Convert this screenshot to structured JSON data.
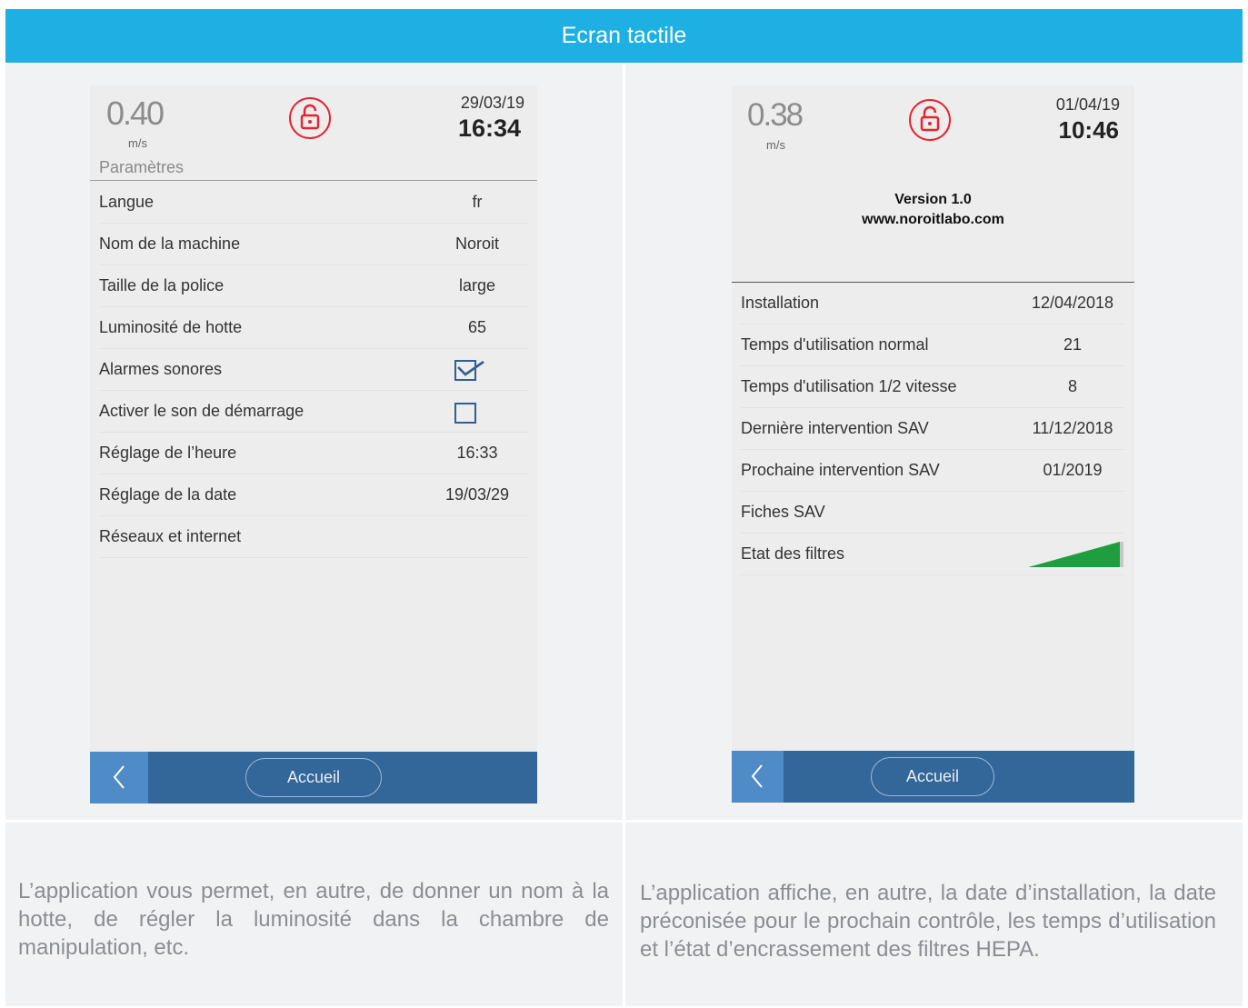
{
  "header": {
    "title": "Ecran tactile"
  },
  "left_screen": {
    "speed": "0.40",
    "unit": "m/s",
    "date": "29/03/19",
    "time": "16:34",
    "section_title": "Paramètres",
    "rows": [
      {
        "label": "Langue",
        "value": "fr"
      },
      {
        "label": "Nom de la machine",
        "value": "Noroit"
      },
      {
        "label": "Taille de la police",
        "value": "large"
      },
      {
        "label": "Luminosité de hotte",
        "value": "65"
      },
      {
        "label": "Alarmes sonores",
        "checkbox": true
      },
      {
        "label": "Activer le son de démarrage",
        "checkbox": false
      },
      {
        "label": "Réglage de l’heure",
        "value": "16:33"
      },
      {
        "label": "Réglage de la date",
        "value": "19/03/29"
      },
      {
        "label": "Réseaux et internet",
        "value": ""
      }
    ],
    "home_label": "Accueil"
  },
  "right_screen": {
    "speed": "0.38",
    "unit": "m/s",
    "date": "01/04/19",
    "time": "10:46",
    "version": "Version 1.0",
    "website": "www.noroitlabo.com",
    "rows": [
      {
        "label": "Installation",
        "value": "12/04/2018"
      },
      {
        "label": "Temps d'utilisation normal",
        "value": "21"
      },
      {
        "label": "Temps d'utilisation 1/2 vitesse",
        "value": "8"
      },
      {
        "label": "Dernière intervention SAV",
        "value": "11/12/2018"
      },
      {
        "label": "Prochaine intervention SAV",
        "value": "01/2019"
      },
      {
        "label": "Fiches SAV",
        "value": ""
      },
      {
        "label": "Etat des filtres",
        "value": ""
      }
    ],
    "filter_level": 0.9,
    "filter_color": "#1e9e3e",
    "home_label": "Accueil"
  },
  "captions": {
    "left": "L’application vous permet, en autre, de donner un nom à la hotte, de régler la luminosité dans la chambre de manipulation, etc.",
    "right": "L’application affiche, en autre, la date d’installation, la date préconisée pour le prochain contrôle, les temps d’utilisation et l’état d’encrassement des filtres HEPA."
  },
  "icons": {
    "lock": "unlocked-padlock-icon",
    "back": "chevron-left-icon",
    "check": "checkmark-icon"
  },
  "colors": {
    "header": "#1fb0e3",
    "bar": "#336699",
    "back": "#4f8bc7",
    "lock": "#e8232f"
  }
}
